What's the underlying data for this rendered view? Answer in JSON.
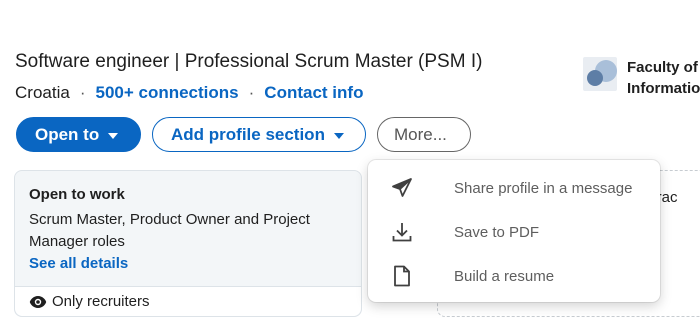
{
  "profile": {
    "headline": "Software engineer | Professional Scrum Master (PSM I)",
    "location": "Croatia",
    "separator": "·",
    "connections": "500+ connections",
    "contact_info": "Contact info"
  },
  "education": {
    "line1": "Faculty of",
    "line2": "Information"
  },
  "actions": {
    "open_to": "Open to",
    "add_profile_section": "Add profile section",
    "more": "More..."
  },
  "open_to_work": {
    "title": "Open to work",
    "roles": "Scrum Master, Product Owner and Project Manager roles",
    "see_all": "See all details",
    "visibility": "Only recruiters"
  },
  "right_card": {
    "partial_text": "attrac"
  },
  "more_menu": {
    "items": [
      {
        "label": "Share profile in a message",
        "icon": "send-icon"
      },
      {
        "label": "Save to PDF",
        "icon": "download-icon"
      },
      {
        "label": "Build a resume",
        "icon": "document-icon"
      }
    ]
  },
  "colors": {
    "brand_blue": "#0a66c2",
    "text": "#1f1f1f",
    "muted": "#5e5e5e",
    "card_bg": "#f3f6f8"
  }
}
